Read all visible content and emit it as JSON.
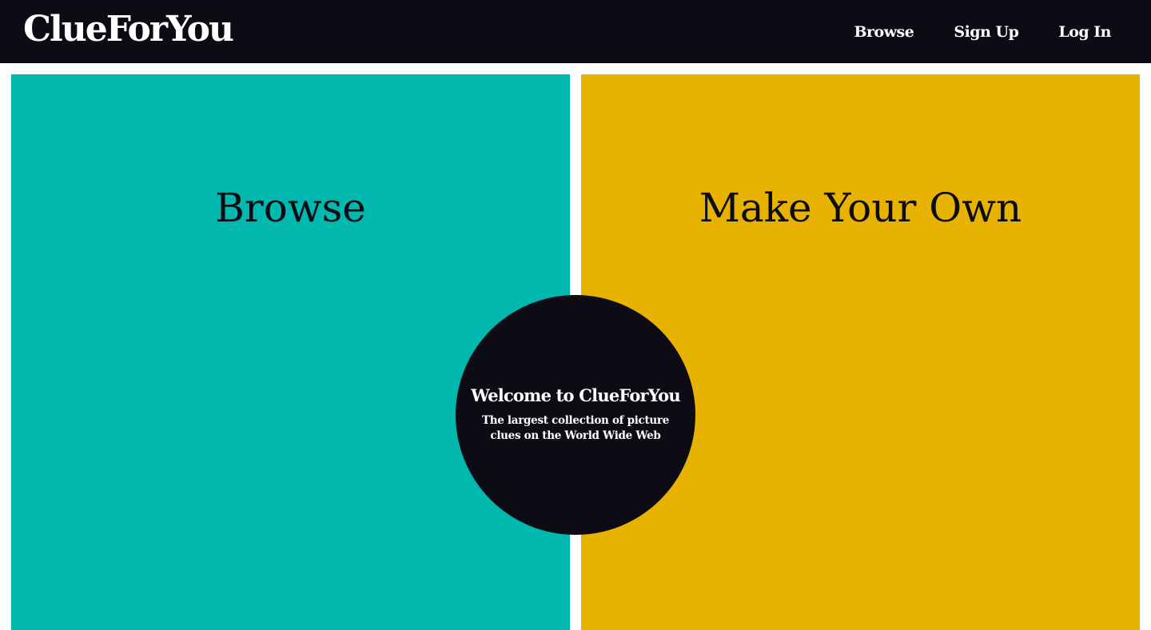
{
  "header": {
    "logo": "ClueForYou",
    "nav": [
      {
        "label": "Browse"
      },
      {
        "label": "Sign Up"
      },
      {
        "label": "Log In"
      }
    ]
  },
  "panels": {
    "browse": {
      "title": "Browse",
      "color": "#00b8ae"
    },
    "make": {
      "title": "Make Your Own",
      "color": "#e8b300"
    }
  },
  "welcome": {
    "title": "Welcome to ClueForYou",
    "subtitle": "The largest collection of picture clues on the World Wide Web"
  },
  "colors": {
    "dark": "#0d0c15",
    "teal": "#00b8ae",
    "gold": "#e8b300"
  }
}
